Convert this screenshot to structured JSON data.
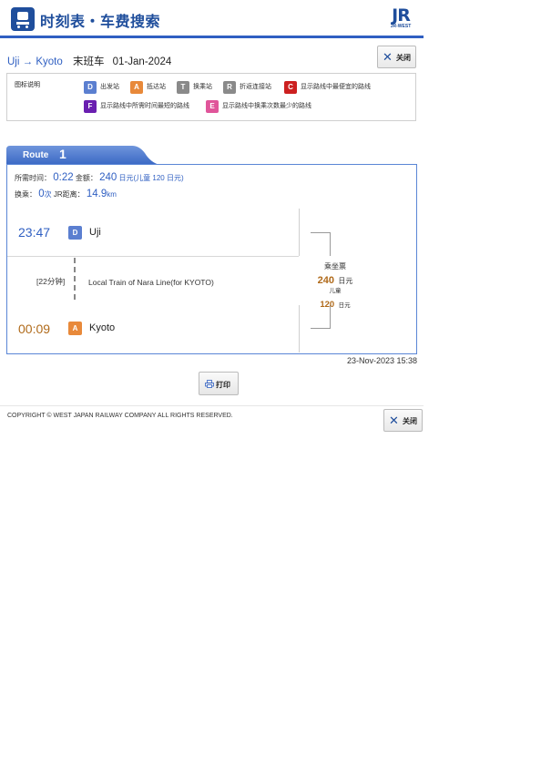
{
  "header": {
    "title": "时刻表・车费搜索",
    "logo_text": "JR",
    "logo_sub": "JR-WEST",
    "icon": "train-icon"
  },
  "search": {
    "from": "Uji",
    "arrow": "→",
    "to": "Kyoto",
    "kind": "末班车",
    "date": "01-Jan-2024",
    "close_label": "关闭"
  },
  "legend": {
    "title": "图标说明",
    "items": [
      {
        "badge": "D",
        "color": "#5b7fd0",
        "label": "出发站"
      },
      {
        "badge": "A",
        "color": "#e8893a",
        "label": "抵达站"
      },
      {
        "badge": "T",
        "color": "#8a8a8a",
        "label": "换乘站"
      },
      {
        "badge": "R",
        "color": "#8a8a8a",
        "label": "折返连接站"
      },
      {
        "badge": "C",
        "color": "#cc2020",
        "label": "显示路线中最便宜的路线"
      },
      {
        "badge": "F",
        "color": "#6a1fb0",
        "label": "显示路线中所需时间最短的路线"
      },
      {
        "badge": "E",
        "color": "#e0559a",
        "label": "显示路线中换乘次数最少的路线"
      }
    ]
  },
  "route": {
    "tab_label": "Route",
    "tab_number": "1",
    "summary": {
      "time_label": "所需时间：",
      "time_value": "0:22",
      "fare_label": "金额：",
      "fare_value": "240",
      "fare_unit": "日元(儿童 120 日元)",
      "transfer_label": "换乘：",
      "transfer_value": "0",
      "transfer_unit": "次",
      "distance_label": "JR距离：",
      "distance_value": "14.9",
      "distance_unit": "km"
    },
    "departure": {
      "time": "23:47",
      "badge": "D",
      "station": "Uji"
    },
    "segment": {
      "duration": "[22分钟]",
      "train": "Local Train of Nara Line(for KYOTO)"
    },
    "arrival": {
      "time": "00:09",
      "badge": "A",
      "station": "Kyoto"
    },
    "fare_box": {
      "title": "乘坐票",
      "adult": "240",
      "unit": "日元",
      "child_label": "儿童",
      "child": "120",
      "child_unit": "日元"
    }
  },
  "updated": "23-Nov-2023 15:38",
  "print_label": "打印",
  "footer": {
    "copyright": "COPYRIGHT © WEST JAPAN RAILWAY COMPANY ALL RIGHTS RESERVED.",
    "close_label": "关闭"
  },
  "colors": {
    "accent": "#2f5fc2",
    "arrival": "#b06a1a",
    "departure_badge": "#5b7fd0",
    "arrival_badge": "#e8893a"
  }
}
